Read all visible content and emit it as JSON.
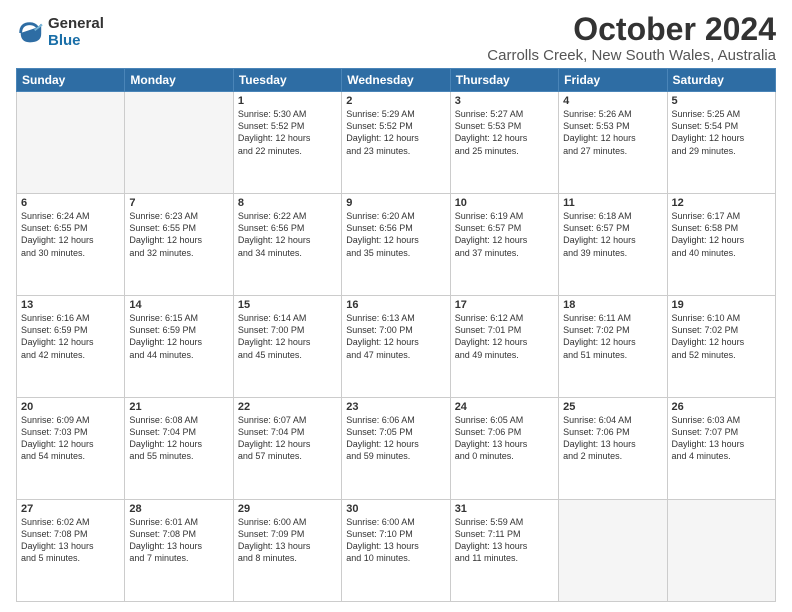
{
  "header": {
    "logo_general": "General",
    "logo_blue": "Blue",
    "title": "October 2024",
    "subtitle": "Carrolls Creek, New South Wales, Australia"
  },
  "weekdays": [
    "Sunday",
    "Monday",
    "Tuesday",
    "Wednesday",
    "Thursday",
    "Friday",
    "Saturday"
  ],
  "weeks": [
    [
      {
        "day": "",
        "info": ""
      },
      {
        "day": "",
        "info": ""
      },
      {
        "day": "1",
        "info": "Sunrise: 5:30 AM\nSunset: 5:52 PM\nDaylight: 12 hours\nand 22 minutes."
      },
      {
        "day": "2",
        "info": "Sunrise: 5:29 AM\nSunset: 5:52 PM\nDaylight: 12 hours\nand 23 minutes."
      },
      {
        "day": "3",
        "info": "Sunrise: 5:27 AM\nSunset: 5:53 PM\nDaylight: 12 hours\nand 25 minutes."
      },
      {
        "day": "4",
        "info": "Sunrise: 5:26 AM\nSunset: 5:53 PM\nDaylight: 12 hours\nand 27 minutes."
      },
      {
        "day": "5",
        "info": "Sunrise: 5:25 AM\nSunset: 5:54 PM\nDaylight: 12 hours\nand 29 minutes."
      }
    ],
    [
      {
        "day": "6",
        "info": "Sunrise: 6:24 AM\nSunset: 6:55 PM\nDaylight: 12 hours\nand 30 minutes."
      },
      {
        "day": "7",
        "info": "Sunrise: 6:23 AM\nSunset: 6:55 PM\nDaylight: 12 hours\nand 32 minutes."
      },
      {
        "day": "8",
        "info": "Sunrise: 6:22 AM\nSunset: 6:56 PM\nDaylight: 12 hours\nand 34 minutes."
      },
      {
        "day": "9",
        "info": "Sunrise: 6:20 AM\nSunset: 6:56 PM\nDaylight: 12 hours\nand 35 minutes."
      },
      {
        "day": "10",
        "info": "Sunrise: 6:19 AM\nSunset: 6:57 PM\nDaylight: 12 hours\nand 37 minutes."
      },
      {
        "day": "11",
        "info": "Sunrise: 6:18 AM\nSunset: 6:57 PM\nDaylight: 12 hours\nand 39 minutes."
      },
      {
        "day": "12",
        "info": "Sunrise: 6:17 AM\nSunset: 6:58 PM\nDaylight: 12 hours\nand 40 minutes."
      }
    ],
    [
      {
        "day": "13",
        "info": "Sunrise: 6:16 AM\nSunset: 6:59 PM\nDaylight: 12 hours\nand 42 minutes."
      },
      {
        "day": "14",
        "info": "Sunrise: 6:15 AM\nSunset: 6:59 PM\nDaylight: 12 hours\nand 44 minutes."
      },
      {
        "day": "15",
        "info": "Sunrise: 6:14 AM\nSunset: 7:00 PM\nDaylight: 12 hours\nand 45 minutes."
      },
      {
        "day": "16",
        "info": "Sunrise: 6:13 AM\nSunset: 7:00 PM\nDaylight: 12 hours\nand 47 minutes."
      },
      {
        "day": "17",
        "info": "Sunrise: 6:12 AM\nSunset: 7:01 PM\nDaylight: 12 hours\nand 49 minutes."
      },
      {
        "day": "18",
        "info": "Sunrise: 6:11 AM\nSunset: 7:02 PM\nDaylight: 12 hours\nand 51 minutes."
      },
      {
        "day": "19",
        "info": "Sunrise: 6:10 AM\nSunset: 7:02 PM\nDaylight: 12 hours\nand 52 minutes."
      }
    ],
    [
      {
        "day": "20",
        "info": "Sunrise: 6:09 AM\nSunset: 7:03 PM\nDaylight: 12 hours\nand 54 minutes."
      },
      {
        "day": "21",
        "info": "Sunrise: 6:08 AM\nSunset: 7:04 PM\nDaylight: 12 hours\nand 55 minutes."
      },
      {
        "day": "22",
        "info": "Sunrise: 6:07 AM\nSunset: 7:04 PM\nDaylight: 12 hours\nand 57 minutes."
      },
      {
        "day": "23",
        "info": "Sunrise: 6:06 AM\nSunset: 7:05 PM\nDaylight: 12 hours\nand 59 minutes."
      },
      {
        "day": "24",
        "info": "Sunrise: 6:05 AM\nSunset: 7:06 PM\nDaylight: 13 hours\nand 0 minutes."
      },
      {
        "day": "25",
        "info": "Sunrise: 6:04 AM\nSunset: 7:06 PM\nDaylight: 13 hours\nand 2 minutes."
      },
      {
        "day": "26",
        "info": "Sunrise: 6:03 AM\nSunset: 7:07 PM\nDaylight: 13 hours\nand 4 minutes."
      }
    ],
    [
      {
        "day": "27",
        "info": "Sunrise: 6:02 AM\nSunset: 7:08 PM\nDaylight: 13 hours\nand 5 minutes."
      },
      {
        "day": "28",
        "info": "Sunrise: 6:01 AM\nSunset: 7:08 PM\nDaylight: 13 hours\nand 7 minutes."
      },
      {
        "day": "29",
        "info": "Sunrise: 6:00 AM\nSunset: 7:09 PM\nDaylight: 13 hours\nand 8 minutes."
      },
      {
        "day": "30",
        "info": "Sunrise: 6:00 AM\nSunset: 7:10 PM\nDaylight: 13 hours\nand 10 minutes."
      },
      {
        "day": "31",
        "info": "Sunrise: 5:59 AM\nSunset: 7:11 PM\nDaylight: 13 hours\nand 11 minutes."
      },
      {
        "day": "",
        "info": ""
      },
      {
        "day": "",
        "info": ""
      }
    ]
  ]
}
